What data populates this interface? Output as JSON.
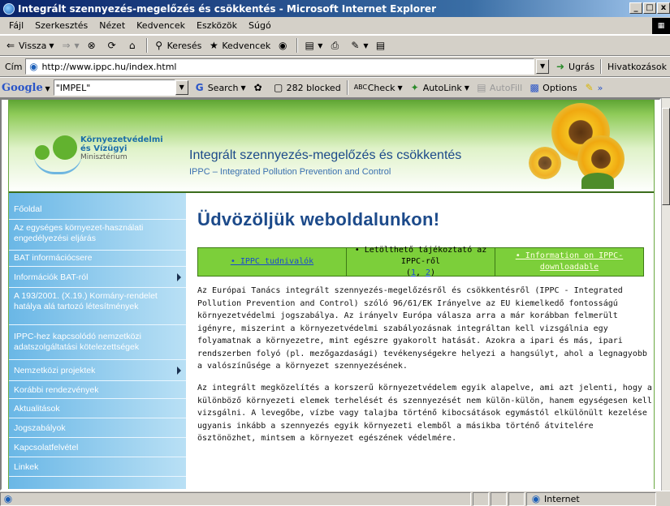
{
  "window": {
    "title": "Integrált szennyezés-megelőzés és csökkentés - Microsoft Internet Explorer",
    "controls": [
      "_",
      "□",
      "x"
    ]
  },
  "menu": [
    "Fájl",
    "Szerkesztés",
    "Nézet",
    "Kedvencek",
    "Eszközök",
    "Súgó"
  ],
  "toolbar": {
    "back": "Vissza",
    "search": "Keresés",
    "favorites": "Kedvencek"
  },
  "address": {
    "label": "Cím",
    "url": "http://www.ippc.hu/index.html",
    "go": "Ugrás",
    "links": "Hivatkozások"
  },
  "google": {
    "logo": "Google",
    "query": "\"IMPEL\"",
    "search": "Search",
    "blocked": "282 blocked",
    "check": "Check",
    "autolink": "AutoLink",
    "autofill": "AutoFill",
    "options": "Options"
  },
  "header": {
    "ministry_line1": "Környezetvédelmi",
    "ministry_line2": "és Vízügyi",
    "ministry_line3": "Minisztérium",
    "title": "Integrált szennyezés-megelőzés és csökkentés",
    "subtitle": "IPPC – Integrated Pollution Prevention and Control"
  },
  "nav": [
    {
      "label": "Főoldal",
      "arrow": false
    },
    {
      "label": "Az egységes környezet-használati engedélyezési eljárás",
      "arrow": false
    },
    {
      "label": "BAT információcsere",
      "arrow": false
    },
    {
      "label": "Információk BAT-ról",
      "arrow": true
    },
    {
      "label": "A 193/2001. (X.19.) Kormány-rendelet hatálya alá tartozó létesítmények",
      "arrow": false
    },
    {
      "label": "IPPC-hez kapcsolódó nemzetközi adatszolgáltatási kötelezettségek",
      "arrow": false
    },
    {
      "label": "Nemzetközi projektek",
      "arrow": true
    },
    {
      "label": "Korábbi rendezvények",
      "arrow": false
    },
    {
      "label": "Aktualitások",
      "arrow": false
    },
    {
      "label": "Jogszabályok",
      "arrow": false
    },
    {
      "label": "Kapcsolatfelvétel",
      "arrow": false
    },
    {
      "label": "Linkek",
      "arrow": false
    }
  ],
  "main": {
    "welcome": "Üdvözöljük weboldalunkon!",
    "tabs": [
      {
        "label": "• IPPC tudnivalók"
      },
      {
        "label": "• Letölthető tájékoztató az IPPC-ről",
        "link1": "1",
        "link2": "2"
      },
      {
        "label": "• Information on IPPC-downloadable"
      }
    ],
    "para1": "Az Európai Tanács integrált szennyezés-megelőzésről és csökkentésről (IPPC - Integrated Pollution Prevention and Control) szóló 96/61/EK Irányelve az EU kiemelkedő fontosságú környezetvédelmi jogszabálya. Az irányelv Európa válasza arra a már korábban felmerült igényre, miszerint a környezetvédelmi szabályozásnak integráltan kell vizsgálnia egy folyamatnak a környezetre, mint egészre gyakorolt hatását. Azokra a ipari és más, ipari rendszerben folyó (pl. mezőgazdasági) tevékenységekre helyezi a hangsúlyt, ahol a legnagyobb a valószínűsége a környezet szennyezésének.",
    "para2": "Az integrált megközelítés a korszerű környezetvédelem egyik alapelve, ami azt jelenti, hogy a különböző környezeti elemek terhelését és szennyezését nem külön-külön, hanem egységesen kell vizsgálni. A levegőbe, vízbe vagy talajba történő kibocsátások egymástól elkülönült kezelése ugyanis inkább a szennyezés egyik környezeti elemből a másikba történő átvitelére ösztönözhet, mintsem a környezet egészének védelmére."
  },
  "status": {
    "zone": "Internet"
  }
}
